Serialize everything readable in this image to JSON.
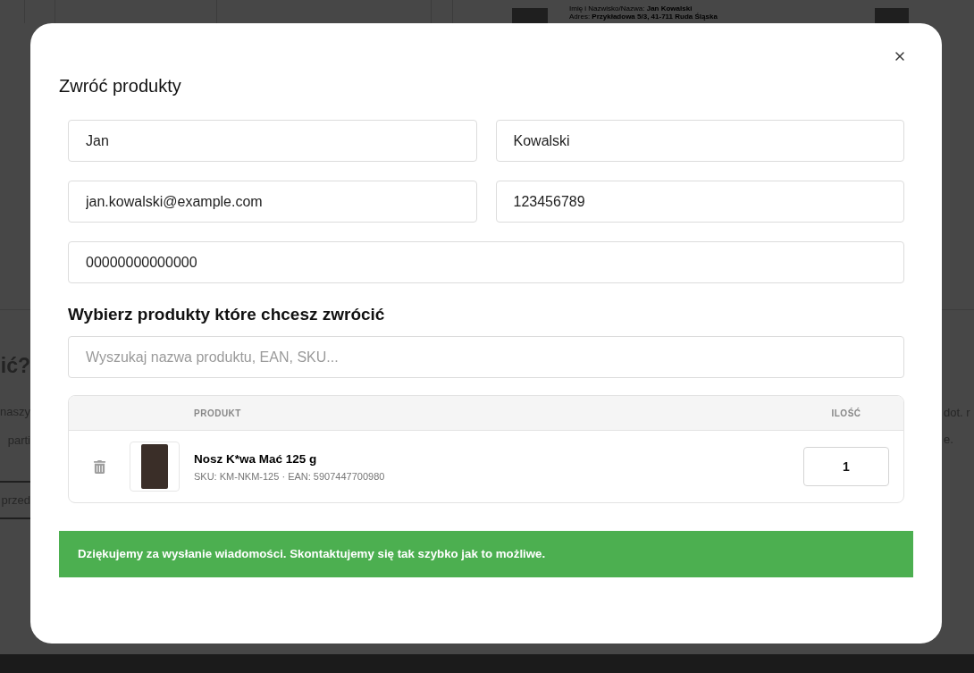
{
  "background_page": {
    "top_info": {
      "name_line": "Imię i Nazwisko/Nazwa: **Jan Kowalski**",
      "address_line": "Adres: **Przykładowa 5/3, 41-711 Ruda Śląska**"
    },
    "left_fragments": {
      "heading": "ić?",
      "line_1": "naszy",
      "line_2": "parti",
      "button": "przed"
    },
    "right_fragments": {
      "line_1": "dot. r",
      "line_2": "e."
    }
  },
  "dialog": {
    "title": "Zwróć produkty",
    "field_rows": [
      [
        {
          "value": "Jan"
        },
        {
          "value": "Kowalski"
        }
      ],
      [
        {
          "value": "jan.kowalski@example.com"
        },
        {
          "value": "123456789"
        }
      ],
      [
        {
          "value": "00000000000000"
        }
      ]
    ],
    "section_heading": "Wybierz produkty które chcesz zwrócić",
    "search": {
      "placeholder": "Wyszukaj nazwa produktu, EAN, SKU..."
    },
    "table": {
      "columns": [
        "PRODUKT",
        "ILOŚĆ"
      ],
      "rows": [
        {
          "name": "Nosz K*wa Mać 125 g",
          "meta": "SKU: KM-NKM-125 · EAN: 5907447700980",
          "quantity": "1"
        }
      ]
    },
    "success_message": "Dziękujemy za wysłanie wiadomości. Skontaktujemy się tak szybko jak to możliwe."
  }
}
